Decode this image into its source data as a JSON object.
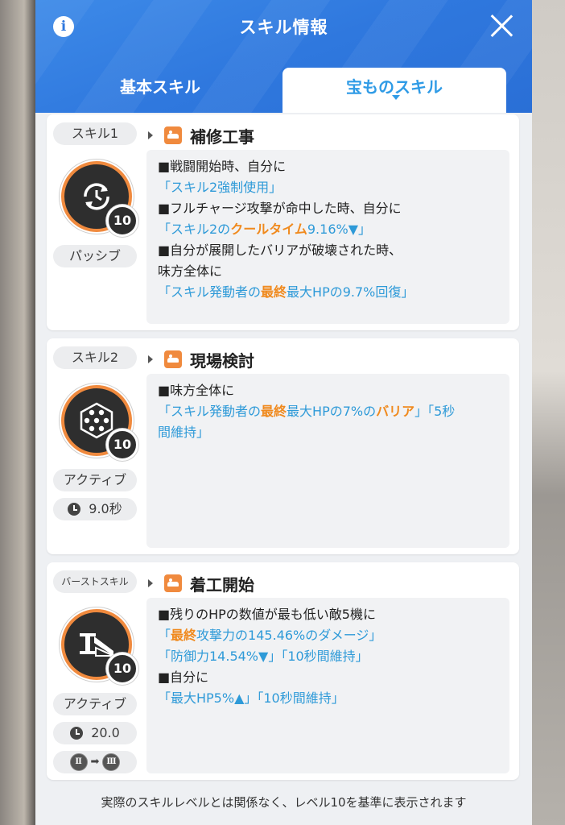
{
  "window": {
    "title": "スキル情報",
    "info_label": "i"
  },
  "tabs": [
    {
      "label": "基本スキル",
      "active": false
    },
    {
      "label": "宝ものスキル",
      "active": true
    }
  ],
  "colors": {
    "header_blue": "#2f78de",
    "accent_orange": "#f08a1e",
    "link_blue": "#2e9ad8"
  },
  "skills": [
    {
      "slot_label": "スキル1",
      "name": "補修工事",
      "type_label": "パッシブ",
      "level": "10",
      "icon": "cooldown-reset-icon",
      "desc": {
        "l1": "■戦闘開始時、自分に",
        "l2": "「スキル2強制使用」",
        "l3": "■フルチャージ攻撃が命中した時、自分に",
        "l4a": "「スキル2の",
        "l4b": "クールタイム",
        "l4c": "9.16%▼」",
        "l5": "■自分が展開したバリアが破壊された時、",
        "l6": "味方全体に",
        "l7a": "「スキル発動者の",
        "l7b": "最終",
        "l7c": "最大HPの9.7%回復」"
      }
    },
    {
      "slot_label": "スキル2",
      "name": "現場検討",
      "type_label": "アクティブ",
      "cooldown": "9.0秒",
      "level": "10",
      "icon": "hexagon-barrier-icon",
      "desc": {
        "l1": "■味方全体に",
        "l2a": "「スキル発動者の",
        "l2b": "最終",
        "l2c": "最大HPの7%の",
        "l2d": "バリア",
        "l2e": "」「5秒",
        "l3": "間維持」"
      }
    },
    {
      "slot_label": "バーストスキル",
      "name": "着工開始",
      "type_label": "アクティブ",
      "cooldown": "20.0",
      "level": "10",
      "icon": "beam-construction-icon",
      "burst_from": "Ⅱ",
      "burst_to": "Ⅲ",
      "desc": {
        "l1": "■残りのHPの数値が最も低い敵5機に",
        "l2a": "「",
        "l2b": "最終",
        "l2c": "攻撃力の145.46%のダメージ」",
        "l3": "「防御力14.54%▼」「10秒間維持」",
        "l4": "■自分に",
        "l5": "「最大HP5%▲」「10秒間維持」"
      }
    }
  ],
  "footer_note": "実際のスキルレベルとは関係なく、レベル10を基準に表示されます"
}
